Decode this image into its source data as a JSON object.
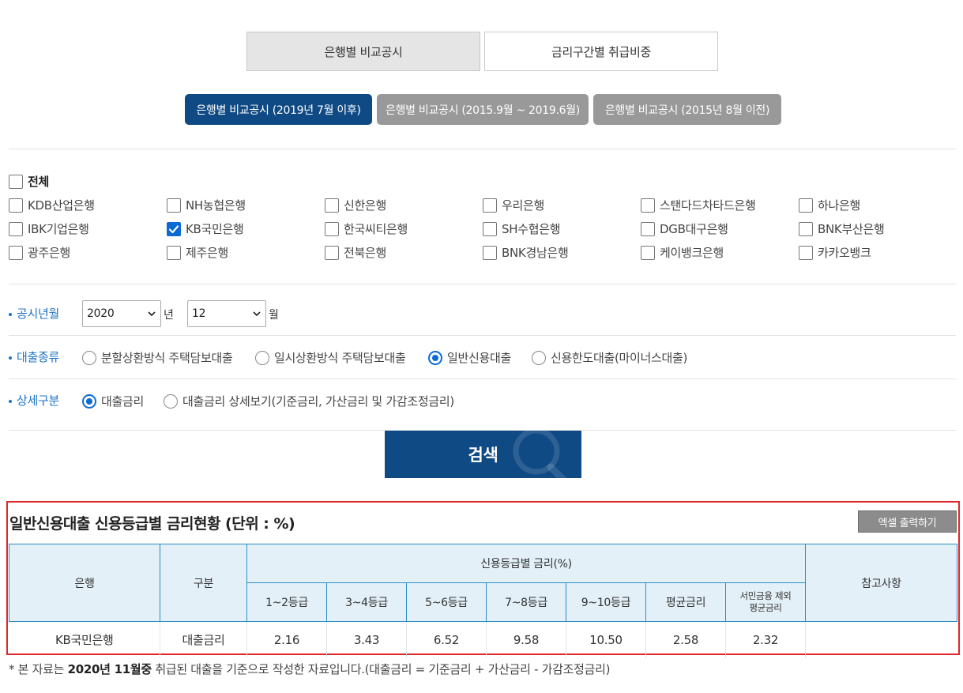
{
  "tabs": [
    "은행별 비교공시",
    "금리구간별 취급비중"
  ],
  "sub_tabs": [
    "은행별 비교공시 (2019년 7월 이후)",
    "은행별 비교공시 (2015.9월 ~ 2019.6월)",
    "은행별 비교공시 (2015년 8월 이전)"
  ],
  "banks": {
    "all_label": "전체",
    "items": [
      {
        "label": "KDB산업은행",
        "checked": false
      },
      {
        "label": "NH농협은행",
        "checked": false
      },
      {
        "label": "신한은행",
        "checked": false
      },
      {
        "label": "우리은행",
        "checked": false
      },
      {
        "label": "스탠다드차타드은행",
        "checked": false
      },
      {
        "label": "하나은행",
        "checked": false
      },
      {
        "label": "IBK기업은행",
        "checked": false
      },
      {
        "label": "KB국민은행",
        "checked": true
      },
      {
        "label": "한국씨티은행",
        "checked": false
      },
      {
        "label": "SH수협은행",
        "checked": false
      },
      {
        "label": "DGB대구은행",
        "checked": false
      },
      {
        "label": "BNK부산은행",
        "checked": false
      },
      {
        "label": "광주은행",
        "checked": false
      },
      {
        "label": "제주은행",
        "checked": false
      },
      {
        "label": "전북은행",
        "checked": false
      },
      {
        "label": "BNK경남은행",
        "checked": false
      },
      {
        "label": "케이뱅크은행",
        "checked": false
      },
      {
        "label": "카카오뱅크",
        "checked": false
      }
    ]
  },
  "filters": {
    "period_label": "공시년월",
    "year": "2020",
    "year_unit": "년",
    "month": "12",
    "month_unit": "월",
    "loan_type_label": "대출종류",
    "loan_types": [
      "분할상환방식 주택담보대출",
      "일시상환방식 주택담보대출",
      "일반신용대출",
      "신용한도대출(마이너스대출)"
    ],
    "loan_type_selected": 2,
    "detail_label": "상세구분",
    "details": [
      "대출금리",
      "대출금리 상세보기(기준금리, 가산금리 및 가감조정금리)"
    ],
    "detail_selected": 0
  },
  "search_label": "검색",
  "result": {
    "title": "일반신용대출 신용등급별 금리현황 (단위 : %)",
    "excel_label": "엑셀 출력하기",
    "headers": {
      "bank": "은행",
      "type": "구분",
      "group": "신용등급별 금리(%)",
      "note": "참고사항",
      "grades": [
        "1~2등급",
        "3~4등급",
        "5~6등급",
        "7~8등급",
        "9~10등급",
        "평균금리"
      ],
      "last_grade_line1": "서민금융 제외",
      "last_grade_line2": "평균금리"
    },
    "rows": [
      {
        "bank": "KB국민은행",
        "type": "대출금리",
        "values": [
          "2.16",
          "3.43",
          "6.52",
          "9.58",
          "10.50",
          "2.58",
          "2.32"
        ],
        "note": ""
      }
    ]
  },
  "footnote": {
    "prefix": "* 본 자료는 ",
    "bold": "2020년 11월중",
    "suffix": " 취급된 대출을 기준으로 작성한 자료입니다.(대출금리 = 기준금리 + 가산금리 - 가감조정금리)"
  }
}
